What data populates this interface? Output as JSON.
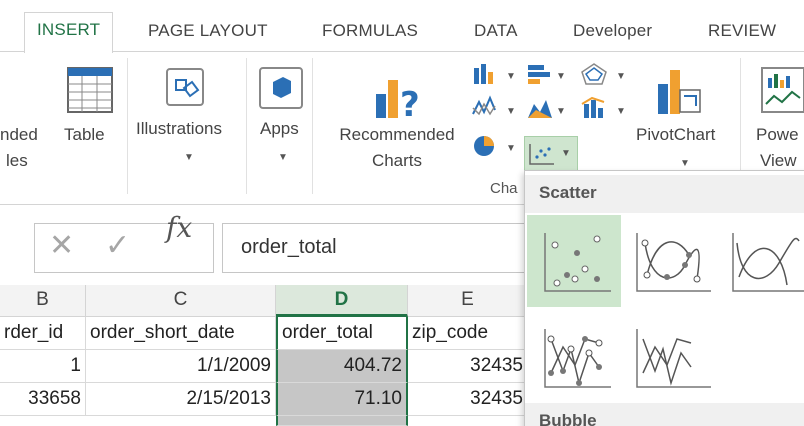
{
  "tabs": [
    {
      "label": "INSERT",
      "active": true
    },
    {
      "label": "PAGE LAYOUT"
    },
    {
      "label": "FORMULAS"
    },
    {
      "label": "DATA"
    },
    {
      "label": "Developer"
    },
    {
      "label": "REVIEW"
    }
  ],
  "ribbon": {
    "pivot_partial_l1": "nded",
    "pivot_partial_l2": "les",
    "table": "Table",
    "illustrations": "Illustrations",
    "apps": "Apps",
    "rec_charts_l1": "Recommended",
    "rec_charts_l2": "Charts",
    "pivotchart": "PivotChart",
    "power_view_l1": "Powe",
    "power_view_l2": "View",
    "charts_group_partial": "Cha"
  },
  "formula_bar": {
    "cancel_glyph": "✕",
    "enter_glyph": "✓",
    "fx_glyph": "fx",
    "content": "order_total"
  },
  "grid": {
    "columns": [
      "B",
      "C",
      "D",
      "E"
    ],
    "selected_column": "D",
    "rows": [
      [
        "rder_id",
        "order_short_date",
        "order_total",
        "zip_code"
      ],
      [
        "1",
        "1/1/2009",
        "404.72",
        "32435"
      ],
      [
        "33658",
        "2/15/2013",
        "71.10",
        "32435"
      ]
    ]
  },
  "dropdown": {
    "section_scatter": "Scatter",
    "section_bubble": "Bubble",
    "options": [
      {
        "name": "Scatter"
      },
      {
        "name": "Scatter with Smooth Lines and Markers"
      },
      {
        "name": "Scatter with Smooth Lines"
      },
      {
        "name": "Scatter with Straight Lines and Markers"
      },
      {
        "name": "Scatter with Straight Lines"
      }
    ]
  },
  "colors": {
    "accent": "#217346",
    "selection_fill": "#c6c6c6",
    "highlight": "#cde6cd"
  }
}
